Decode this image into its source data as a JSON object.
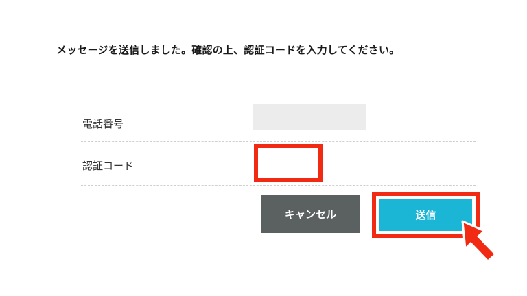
{
  "message": "メッセージを送信しました。確認の上、認証コードを入力してください。",
  "form": {
    "phone_label": "電話番号",
    "phone_value": "",
    "code_label": "認証コード",
    "code_value": ""
  },
  "buttons": {
    "cancel_label": "キャンセル",
    "submit_label": "送信"
  },
  "colors": {
    "highlight": "#f12a13",
    "submit": "#1bb5d6",
    "cancel": "#5b6061"
  },
  "icons": {
    "pointer": "pointer-arrow-icon"
  }
}
